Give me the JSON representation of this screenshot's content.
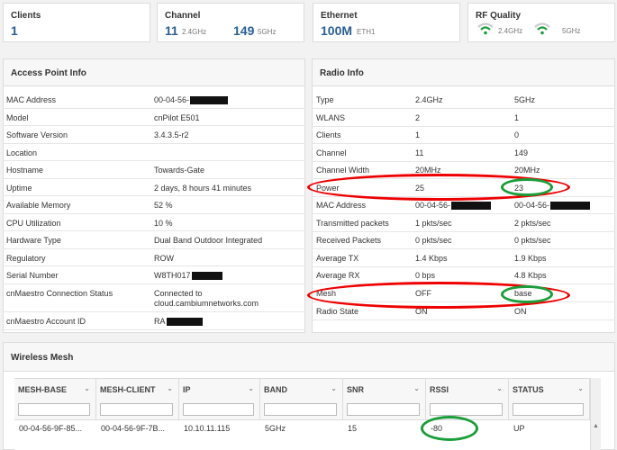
{
  "stats": {
    "clients": {
      "title": "Clients",
      "value": "1"
    },
    "channel": {
      "title": "Channel",
      "v1": "11",
      "s1": "2.4GHz",
      "v2": "149",
      "s2": "5GHz"
    },
    "ethernet": {
      "title": "Ethernet",
      "value": "100M",
      "sub": "ETH1"
    },
    "rf": {
      "title": "RF Quality",
      "s1": "2.4GHz",
      "s2": "5GHz"
    }
  },
  "ap_info": {
    "title": "Access Point Info",
    "rows": [
      {
        "label": "MAC Address",
        "value": "00-04-56-"
      },
      {
        "label": "Model",
        "value": "cnPilot E501"
      },
      {
        "label": "Software Version",
        "value": "3.4.3.5-r2"
      },
      {
        "label": "Location",
        "value": ""
      },
      {
        "label": "Hostname",
        "value": "Towards-Gate"
      },
      {
        "label": "Uptime",
        "value": "2 days, 8 hours 41 minutes"
      },
      {
        "label": "Available Memory",
        "value": "52 %"
      },
      {
        "label": "CPU Utilization",
        "value": "10 %"
      },
      {
        "label": "Hardware Type",
        "value": "Dual Band Outdoor Integrated"
      },
      {
        "label": "Regulatory",
        "value": "ROW"
      },
      {
        "label": "Serial Number",
        "value": "W8TH017"
      },
      {
        "label": "cnMaestro Connection Status",
        "value": "Connected to",
        "value2": "cloud.cambiumnetworks.com"
      },
      {
        "label": "cnMaestro Account ID",
        "value": "RA"
      }
    ]
  },
  "radio_info": {
    "title": "Radio Info",
    "rows": [
      {
        "label": "Type",
        "a": "2.4GHz",
        "b": "5GHz"
      },
      {
        "label": "WLANS",
        "a": "2",
        "b": "1"
      },
      {
        "label": "Clients",
        "a": "1",
        "b": "0"
      },
      {
        "label": "Channel",
        "a": "11",
        "b": "149"
      },
      {
        "label": "Channel Width",
        "a": "20MHz",
        "b": "20MHz"
      },
      {
        "label": "Power",
        "a": "25",
        "b": "23"
      },
      {
        "label": "MAC Address",
        "a": "00-04-56-",
        "b": "00-04-56-"
      },
      {
        "label": "Transmitted packets",
        "a": "1 pkts/sec",
        "b": "2 pkts/sec"
      },
      {
        "label": "Received Packets",
        "a": "0 pkts/sec",
        "b": "0 pkts/sec"
      },
      {
        "label": "Average TX",
        "a": "1.4 Kbps",
        "b": "1.9 Kbps"
      },
      {
        "label": "Average RX",
        "a": "0 bps",
        "b": "4.8 Kbps"
      },
      {
        "label": "Mesh",
        "a": "OFF",
        "b": "base"
      },
      {
        "label": "Radio State",
        "a": "ON",
        "b": "ON"
      }
    ]
  },
  "mesh": {
    "title": "Wireless Mesh",
    "columns": [
      "MESH-BASE",
      "MESH-CLIENT",
      "IP",
      "BAND",
      "SNR",
      "RSSI",
      "STATUS"
    ],
    "row": [
      "00-04-56-9F-85...",
      "00-04-56-9F-7B...",
      "10.10.11.115",
      "5GHz",
      "15",
      "-80",
      "UP"
    ]
  },
  "colors": {
    "accent": "#2a5f93",
    "annotation_red": "#e00000",
    "annotation_green": "#1a9e3a"
  }
}
